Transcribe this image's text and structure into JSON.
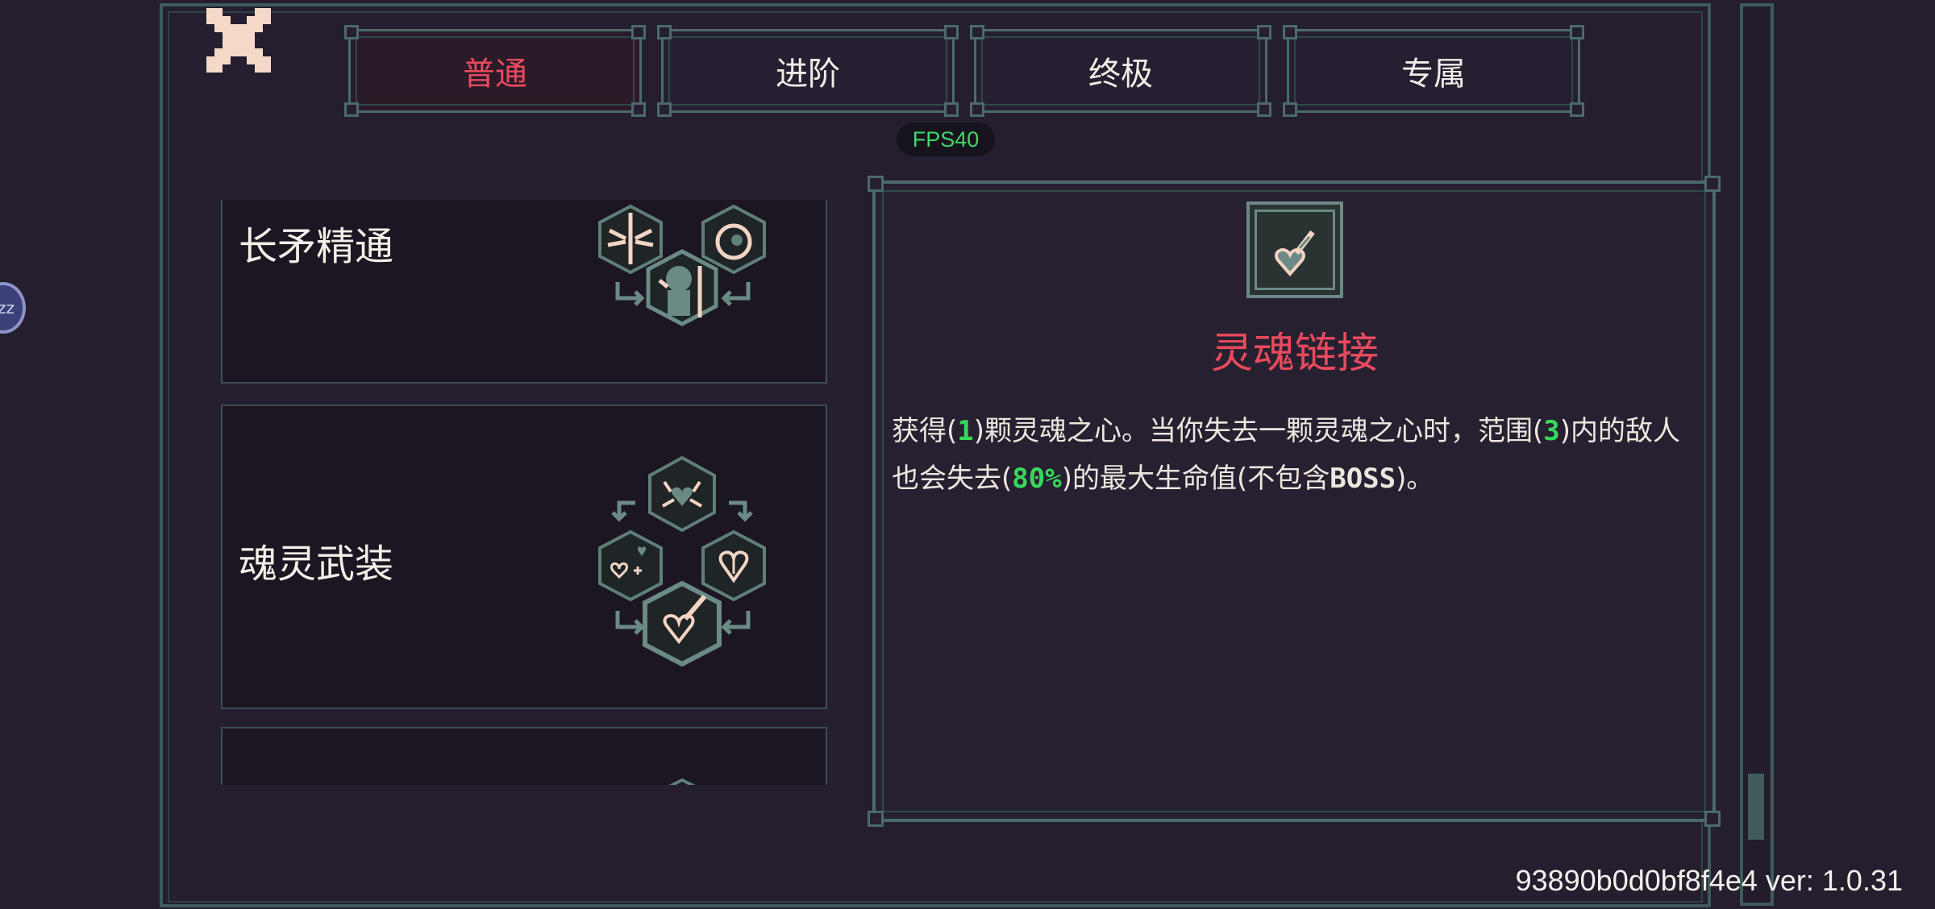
{
  "tabs": [
    {
      "label": "普通",
      "active": true
    },
    {
      "label": "进阶",
      "active": false
    },
    {
      "label": "终极",
      "active": false
    },
    {
      "label": "专属",
      "active": false
    }
  ],
  "fps": "FPS40",
  "skill_list": [
    {
      "title": "长矛精通"
    },
    {
      "title": "魂灵武装"
    }
  ],
  "detail": {
    "name": "灵魂链接",
    "description": {
      "p1": "获得(",
      "v1": "1",
      "p2": ")颗灵魂之心。当你失去一颗灵魂之心时，范围(",
      "v2": "3",
      "p3": ")内的敌人也会失去(",
      "v3": "80%",
      "p4": ")的最大生命值(不包含",
      "boss": "BOSS",
      "p5": ")。"
    }
  },
  "version_text": "93890b0d0bf8f4e4 ver: 1.0.31",
  "colors": {
    "active_tab_text": "#e94a5e",
    "highlight_number": "#36d85a",
    "frame": "#4b6a6b",
    "background": "#241e2e"
  }
}
